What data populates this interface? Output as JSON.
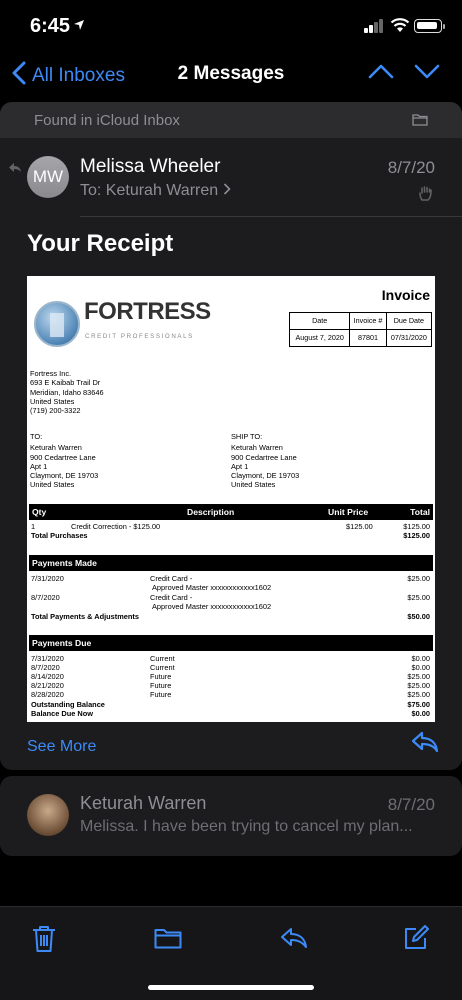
{
  "status": {
    "time": "6:45"
  },
  "nav": {
    "back_label": "All Inboxes",
    "title": "2 Messages"
  },
  "message": {
    "found_in": "Found in iCloud Inbox",
    "avatar_initials": "MW",
    "sender": "Melissa Wheeler",
    "to_prefix": "To:",
    "recipient": "Keturah Warren",
    "date": "8/7/20",
    "subject": "Your Receipt",
    "see_more": "See More"
  },
  "invoice": {
    "title": "Invoice",
    "logo_word": "FORTRESS",
    "logo_sub": "CREDIT PROFESSIONALS",
    "meta_headers": [
      "Date",
      "Invoice #",
      "Due Date"
    ],
    "meta_values": [
      "August 7, 2020",
      "87801",
      "07/31/2020"
    ],
    "company": [
      "Fortress Inc.",
      "693 E Kaibab Trail Dr",
      "Meridian, Idaho 83646",
      "United States",
      "(719) 200-3322"
    ],
    "to_label": "TO:",
    "to": [
      "Keturah Warren",
      "900 Cedartree Lane",
      "Apt 1",
      "Claymont, DE 19703",
      "United States"
    ],
    "ship_label": "SHIP TO:",
    "ship": [
      "Keturah Warren",
      "900 Cedartree Lane",
      "Apt 1",
      "Claymont, DE 19703",
      "United States"
    ],
    "items_headers": {
      "qty": "Qty",
      "description": "Description",
      "unit_price": "Unit Price",
      "total": "Total"
    },
    "item": {
      "qty": "1",
      "description": "Credit Correction - $125.00",
      "unit_price": "$125.00",
      "total": "$125.00"
    },
    "total_purchases_label": "Total Purchases",
    "total_purchases": "$125.00",
    "payments_made_label": "Payments Made",
    "payments": [
      {
        "date": "7/31/2020",
        "method": "Credit Card -",
        "detail": "Approved  Master xxxxxxxxxxxx1602",
        "amount": "$25.00"
      },
      {
        "date": "8/7/2020",
        "method": "Credit Card -",
        "detail": "Approved  Master xxxxxxxxxxxx1602",
        "amount": "$25.00"
      }
    ],
    "total_payments_label": "Total Payments & Adjustments",
    "total_payments": "$50.00",
    "payments_due_label": "Payments Due",
    "due": [
      {
        "date": "7/31/2020",
        "status": "Current",
        "amount": "$0.00"
      },
      {
        "date": "8/7/2020",
        "status": "Current",
        "amount": "$0.00"
      },
      {
        "date": "8/14/2020",
        "status": "Future",
        "amount": "$25.00"
      },
      {
        "date": "8/21/2020",
        "status": "Future",
        "amount": "$25.00"
      },
      {
        "date": "8/28/2020",
        "status": "Future",
        "amount": "$25.00"
      }
    ],
    "outstanding_label": "Outstanding Balance",
    "outstanding": "$75.00",
    "balance_due_label": "Balance Due Now",
    "balance_due": "$0.00"
  },
  "message2": {
    "sender": "Keturah Warren",
    "date": "8/7/20",
    "preview": "Melissa. I have been trying to cancel my plan..."
  },
  "colors": {
    "accent": "#3d8af7",
    "background": "#000000",
    "card": "#1c1c1e",
    "secondary_text": "#8e8e93"
  },
  "icons": [
    "location-arrow-icon",
    "signal-icon",
    "wifi-icon",
    "battery-icon",
    "chevron-left-icon",
    "chevron-up-icon",
    "chevron-down-icon",
    "folder-icon",
    "reply-indicator-icon",
    "chevron-right-icon",
    "hand-icon",
    "reply-icon",
    "trash-icon",
    "compose-icon"
  ]
}
